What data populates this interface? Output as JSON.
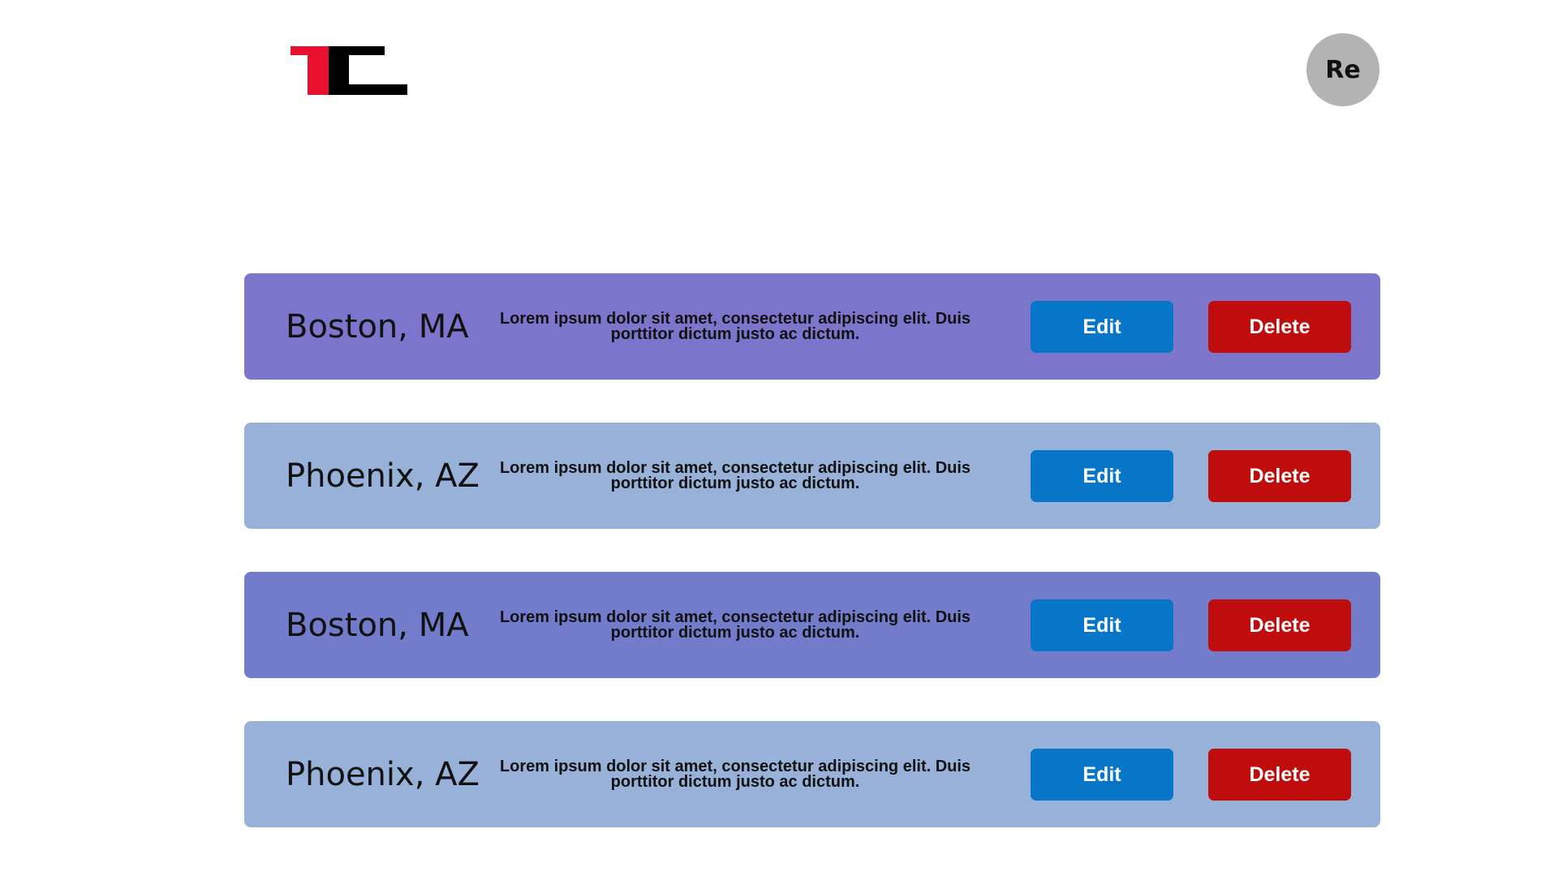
{
  "header": {
    "logo_alt": "TE",
    "avatar_initials": "Re"
  },
  "colors": {
    "logo_red": "#e8102f",
    "logo_black": "#000000",
    "card_purple": "#7b76cc",
    "card_blue_gray": "#98b1d9",
    "edit_button": "#0775c8",
    "delete_button": "#bf0d0d",
    "avatar_bg": "#b3b3b3"
  },
  "locations": [
    {
      "city": "Boston, MA",
      "description": "Lorem ipsum dolor sit amet, consectetur adipiscing elit. Duis porttitor dictum justo ac dictum.",
      "edit_label": "Edit",
      "delete_label": "Delete",
      "color": "#7b76cc"
    },
    {
      "city": "Phoenix, AZ",
      "description": "Lorem ipsum dolor sit amet, consectetur adipiscing elit. Duis porttitor dictum justo ac dictum.",
      "edit_label": "Edit",
      "delete_label": "Delete",
      "color": "#98b1d9"
    },
    {
      "city": "Boston, MA",
      "description": "Lorem ipsum dolor sit amet, consectetur adipiscing elit. Duis porttitor dictum justo ac dictum.",
      "edit_label": "Edit",
      "delete_label": "Delete",
      "color": "#727cca"
    },
    {
      "city": "Phoenix, AZ",
      "description": "Lorem ipsum dolor sit amet, consectetur adipiscing elit. Duis porttitor dictum justo ac dictum.",
      "edit_label": "Edit",
      "delete_label": "Delete",
      "color": "#98b1d9"
    }
  ]
}
